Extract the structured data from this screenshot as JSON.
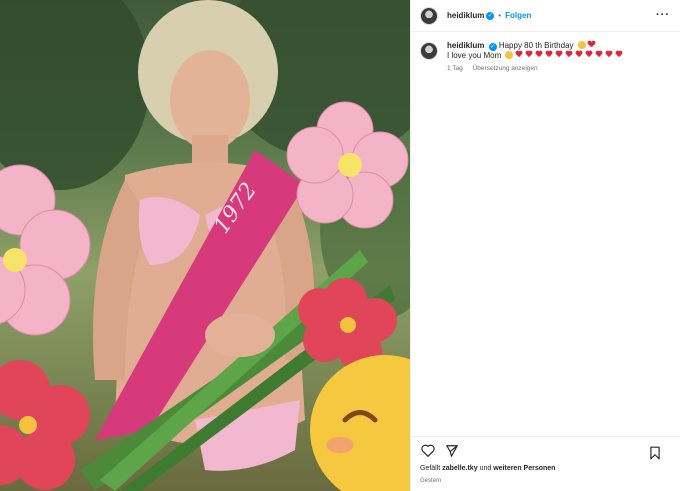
{
  "header": {
    "username": "heidiklum",
    "separator": "•",
    "follow_label": "Folgen",
    "more_icon": "more-horizontal-icon"
  },
  "caption": {
    "username": "heidiklum",
    "line1": "Happy 80 th Birthday",
    "line2": "I love you Mom",
    "time": "1 Tag",
    "translate_label": "Übersetzung anzeigen"
  },
  "photo": {
    "sash_text": "1972"
  },
  "actions": {
    "like_icon": "heart-outline-icon",
    "share_icon": "send-icon",
    "save_icon": "bookmark-icon"
  },
  "likes": {
    "prefix": "Gefällt",
    "user": "zabelle.tky",
    "middle": "und",
    "suffix": "weiteren Personen"
  },
  "posted": "Gestern",
  "colors": {
    "accent": "#0095f6",
    "heart": "#e0243a",
    "sash": "#d63a7a"
  }
}
